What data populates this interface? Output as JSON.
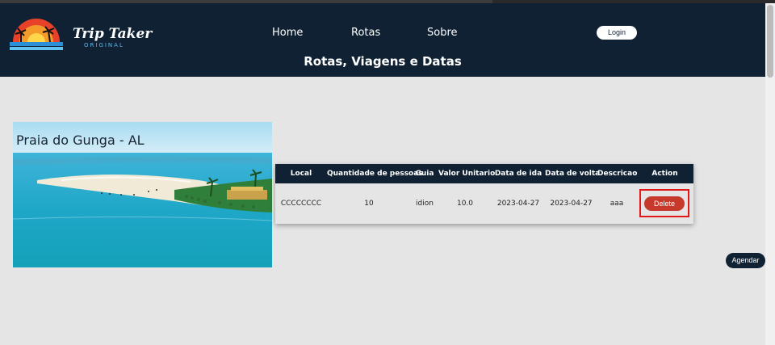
{
  "header": {
    "brand_name": "Trip Taker",
    "brand_sub": "ORIGINAL",
    "nav": [
      "Home",
      "Rotas",
      "Sobre"
    ],
    "login_label": "Login",
    "page_title": "Rotas, Viagens e Datas"
  },
  "destination": {
    "title": "Praia do Gunga - AL"
  },
  "table": {
    "headers": [
      "Local",
      "Quantidade de pessoas",
      "Guia",
      "Valor Unitario",
      "Data de ida",
      "Data de volta",
      "Descricao",
      "Action"
    ],
    "rows": [
      {
        "local": "CCCCCCCC",
        "quantidade": "10",
        "guia": "idion",
        "valor": "10.0",
        "data_ida": "2023-04-27",
        "data_volta": "2023-04-27",
        "descricao": "aaa",
        "action_label": "Delete"
      }
    ]
  },
  "agendar_label": "Agendar",
  "colors": {
    "header_bg": "#0f2133",
    "page_bg": "#e5e5e5",
    "delete_bg": "#c73a2b",
    "highlight": "#e01818"
  }
}
